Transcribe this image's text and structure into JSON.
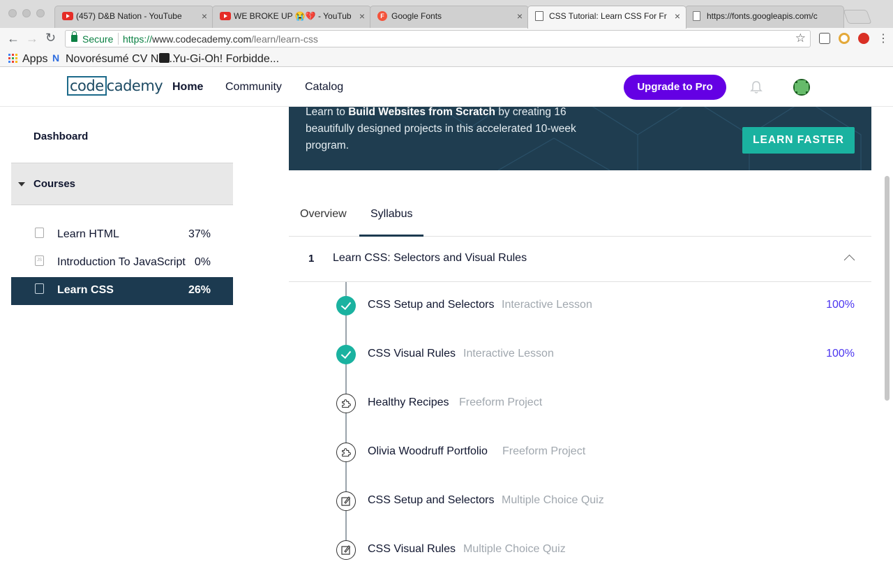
{
  "browser": {
    "tabs": [
      {
        "title": "(457) D&B Nation - YouTube",
        "icon": "youtube-icon"
      },
      {
        "title": "WE BROKE UP 😭💔 - YouTub",
        "icon": "youtube-icon"
      },
      {
        "title": "Google Fonts",
        "icon": "google-fonts-icon"
      },
      {
        "title": "CSS Tutorial: Learn CSS For Fr",
        "icon": "codecademy-icon"
      },
      {
        "title": "https://fonts.googleapis.com/c",
        "icon": "document-icon"
      }
    ],
    "secure_label": "Secure",
    "url_scheme": "https://",
    "url_host": "www.codecademy.com",
    "url_path": "/learn/learn-css",
    "bookmarks": [
      "Apps",
      "Novorésumé CV NE...",
      "Yu-Gi-Oh! Forbidde..."
    ]
  },
  "site": {
    "logo_left": "code",
    "logo_right": "cademy",
    "nav": [
      "Home",
      "Community",
      "Catalog"
    ],
    "upgrade_label": "Upgrade to Pro"
  },
  "sidebar": {
    "dashboard": "Dashboard",
    "courses_label": "Courses",
    "courses": [
      {
        "title": "Learn HTML",
        "percent": "37%",
        "icon_text": ""
      },
      {
        "title": "Introduction To JavaScript",
        "percent": "0%",
        "icon_text": "JS"
      },
      {
        "title": "Learn CSS",
        "percent": "26%",
        "icon_text": ""
      }
    ]
  },
  "banner": {
    "prefix": "Learn to ",
    "bold": "Build Websites from Scratch",
    "suffix": " by creating 16 beautifully designed projects in this accelerated 10-week program.",
    "button": "LEARN FASTER"
  },
  "tabs": [
    "Overview",
    "Syllabus"
  ],
  "module": {
    "number": "1",
    "title": "Learn CSS: Selectors and Visual Rules",
    "items": [
      {
        "title": "CSS Setup and Selectors",
        "type": "Interactive Lesson",
        "percent": "100%",
        "status": "done"
      },
      {
        "title": "CSS Visual Rules",
        "type": "Interactive Lesson",
        "percent": "100%",
        "status": "done"
      },
      {
        "title": "Healthy Recipes",
        "type": "Freeform Project",
        "percent": "",
        "status": "project"
      },
      {
        "title": "Olivia Woodruff Portfolio",
        "type": "Freeform Project",
        "percent": "",
        "status": "project"
      },
      {
        "title": "CSS Setup and Selectors",
        "type": "Multiple Choice Quiz",
        "percent": "",
        "status": "quiz"
      },
      {
        "title": "CSS Visual Rules",
        "type": "Multiple Choice Quiz",
        "percent": "",
        "status": "quiz"
      }
    ]
  },
  "colors": {
    "brand_purple": "#6400e4",
    "teal": "#1ab2a0",
    "navy": "#1c3a50",
    "percent_blue": "#4b35ef"
  }
}
